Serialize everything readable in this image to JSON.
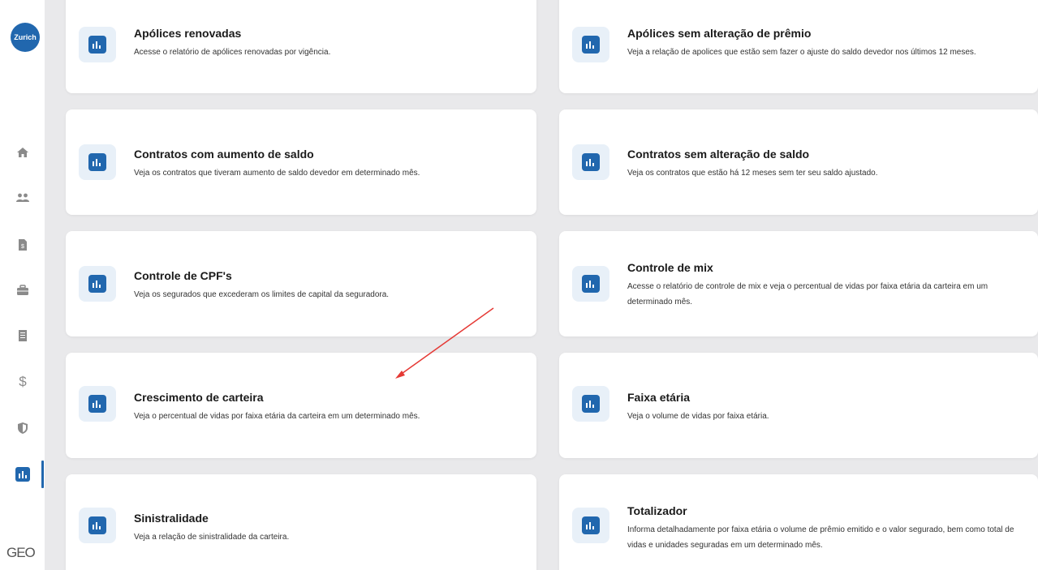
{
  "sidebar": {
    "logo_text": "Zurich",
    "items": [
      {
        "icon": "home-icon"
      },
      {
        "icon": "users-icon"
      },
      {
        "icon": "invoice-icon"
      },
      {
        "icon": "briefcase-icon"
      },
      {
        "icon": "document-icon"
      },
      {
        "icon": "dollar-icon"
      },
      {
        "icon": "shield-icon"
      },
      {
        "icon": "reports-icon",
        "active": true
      }
    ],
    "footer_brand": "GEO"
  },
  "cards": [
    {
      "title": "Apólices renovadas",
      "desc": "Acesse o relatório de apólices renovadas por vigência."
    },
    {
      "title": "Apólices sem alteração de prêmio",
      "desc": "Veja a relação de apolices que estão sem fazer o ajuste do saldo devedor nos últimos 12 meses."
    },
    {
      "title": "Contratos com aumento de saldo",
      "desc": "Veja os contratos que tiveram aumento de saldo devedor em determinado mês."
    },
    {
      "title": "Contratos sem alteração de saldo",
      "desc": "Veja os contratos que estão há 12 meses sem ter seu saldo ajustado."
    },
    {
      "title": "Controle de CPF's",
      "desc": "Veja os segurados que excederam os limites de capital da seguradora."
    },
    {
      "title": "Controle de mix",
      "desc": "Acesse o relatório de controle de mix e veja o percentual de vidas por faixa etária da carteira em um determinado mês."
    },
    {
      "title": "Crescimento de carteira",
      "desc": "Veja o percentual de vidas por faixa etária da carteira em um determinado mês."
    },
    {
      "title": "Faixa etária",
      "desc": "Veja o volume de vidas por faixa etária."
    },
    {
      "title": "Sinistralidade",
      "desc": "Veja a relação de sinistralidade da carteira."
    },
    {
      "title": "Totalizador",
      "desc": "Informa detalhadamente por faixa etária o volume de prêmio emitido e o valor segurado, bem como total de vidas e unidades seguradas em um determinado mês."
    }
  ],
  "colors": {
    "accent": "#2167ae",
    "icon_bg": "#e8f0f8",
    "background": "#e9e9eb",
    "annotation_arrow": "#e53935"
  }
}
